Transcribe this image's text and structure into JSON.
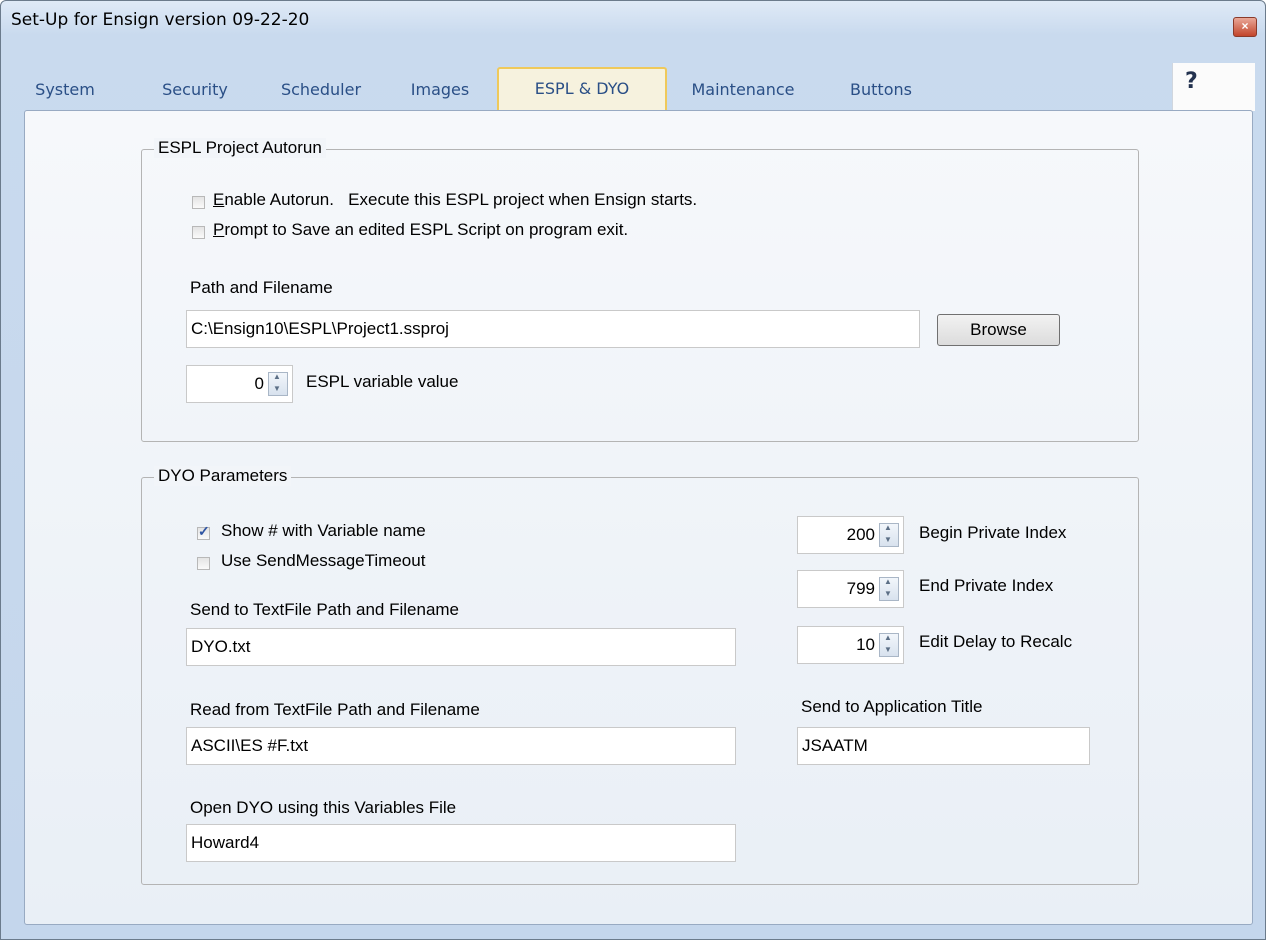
{
  "window": {
    "title": "Set-Up for Ensign version 09-22-20",
    "close_glyph": "×"
  },
  "tabs": [
    {
      "label": "System"
    },
    {
      "label": "Security"
    },
    {
      "label": "Scheduler"
    },
    {
      "label": "Images"
    },
    {
      "label": "ESPL & DYO",
      "active": true
    },
    {
      "label": "Maintenance"
    },
    {
      "label": "Buttons"
    }
  ],
  "help": {
    "label": "?"
  },
  "espl": {
    "legend": "ESPL Project Autorun",
    "enable_autorun": {
      "label_first": "E",
      "label_rest": "nable Autorun.   Execute this ESPL project when Ensign starts.",
      "checked": false
    },
    "prompt_save": {
      "label_first": "P",
      "label_rest": "rompt to Save an edited ESPL Script on program exit.",
      "checked": false
    },
    "path_label": "Path and Filename",
    "path_value": "C:\\Ensign10\\ESPL\\Project1.ssproj",
    "browse_label": "Browse",
    "variable_value": "0",
    "variable_label": "ESPL variable value"
  },
  "dyo": {
    "legend": "DYO Parameters",
    "show_number": {
      "label": "Show # with Variable name",
      "checked": true
    },
    "use_sendmessage": {
      "label": "Use SendMessageTimeout",
      "checked": false
    },
    "send_textfile_label": "Send to TextFile Path and Filename",
    "send_textfile_value": "DYO.txt",
    "read_textfile_label": "Read from TextFile Path and Filename",
    "read_textfile_value": "ASCII\\ES #F.txt",
    "open_dyo_label": "Open DYO using this Variables File",
    "open_dyo_value": "Howard4",
    "begin_private_value": "200",
    "begin_private_label": "Begin Private Index",
    "end_private_value": "799",
    "end_private_label": "End Private Index",
    "edit_delay_value": "10",
    "edit_delay_label": "Edit Delay to Recalc",
    "app_title_label": "Send to Application Title",
    "app_title_value": "JSAATM"
  }
}
